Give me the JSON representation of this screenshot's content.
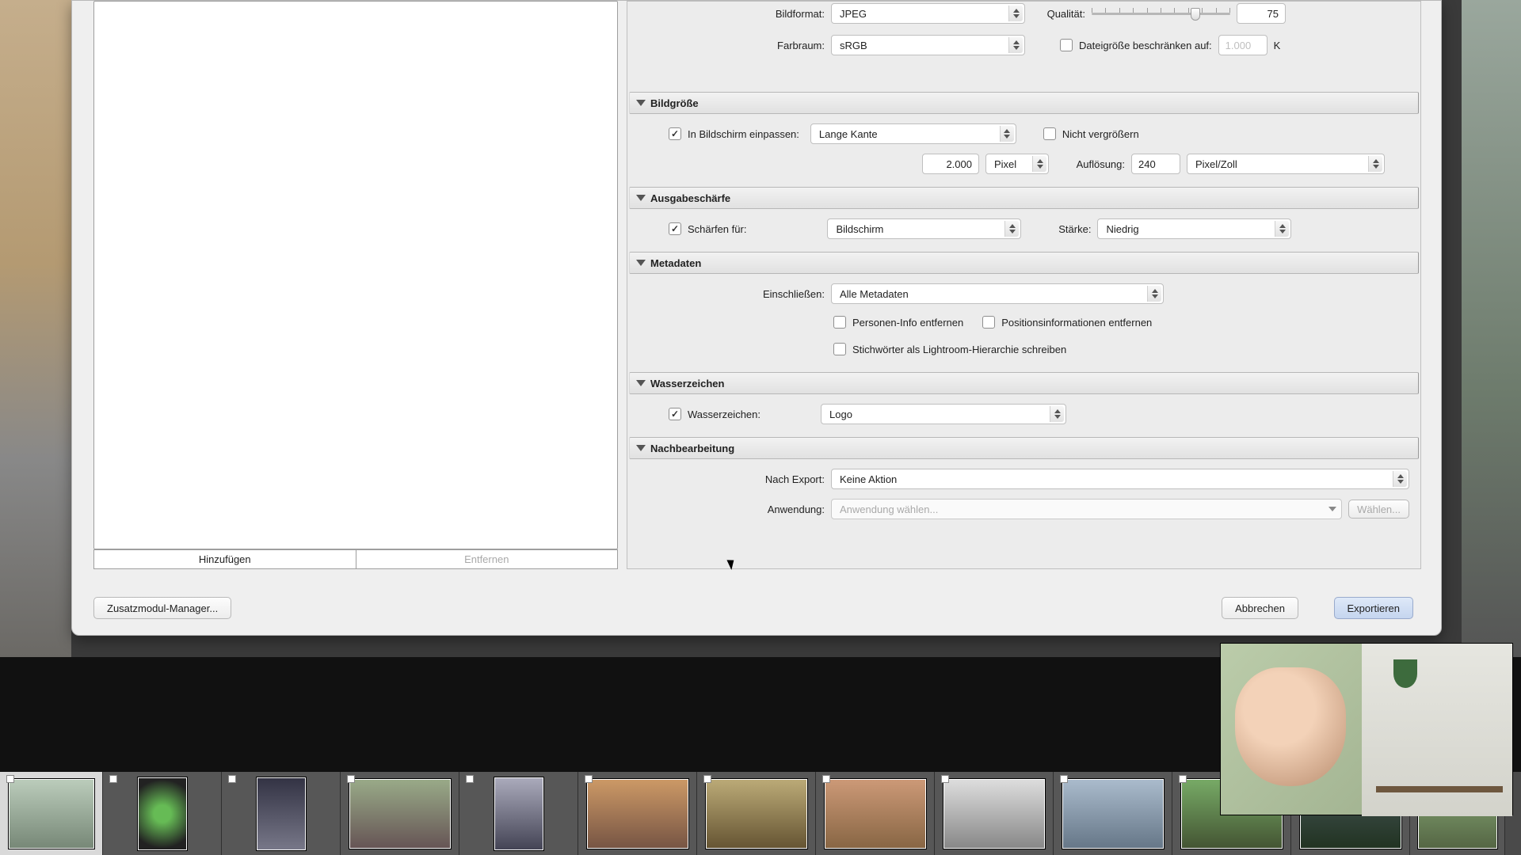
{
  "file_settings": {
    "format_label": "Bildformat:",
    "format_value": "JPEG",
    "quality_label": "Qualität:",
    "quality_value": "75",
    "quality_percent": 75,
    "colorspace_label": "Farbraum:",
    "colorspace_value": "sRGB",
    "limit_label": "Dateigröße beschränken auf:",
    "limit_value": "1.000",
    "limit_unit": "K"
  },
  "sections": {
    "size": {
      "title": "Bildgröße",
      "fit_label": "In Bildschirm einpassen:",
      "fit_value": "Lange Kante",
      "noenlarge": "Nicht vergrößern",
      "dim_value": "2.000",
      "dim_unit": "Pixel",
      "res_label": "Auflösung:",
      "res_value": "240",
      "res_unit": "Pixel/Zoll"
    },
    "sharpen": {
      "title": "Ausgabeschärfe",
      "for_label": "Schärfen für:",
      "for_value": "Bildschirm",
      "amount_label": "Stärke:",
      "amount_value": "Niedrig"
    },
    "meta": {
      "title": "Metadaten",
      "include_label": "Einschließen:",
      "include_value": "Alle Metadaten",
      "remove_person": "Personen-Info entfernen",
      "remove_location": "Positionsinformationen entfernen",
      "keyword_hier": "Stichwörter als Lightroom-Hierarchie schreiben"
    },
    "watermark": {
      "title": "Wasserzeichen",
      "label": "Wasserzeichen:",
      "value": "Logo"
    },
    "post": {
      "title": "Nachbearbeitung",
      "after_label": "Nach Export:",
      "after_value": "Keine Aktion",
      "app_label": "Anwendung:",
      "app_placeholder": "Anwendung wählen...",
      "choose": "Wählen..."
    }
  },
  "left_buttons": {
    "add": "Hinzufügen",
    "remove": "Entfernen"
  },
  "footer": {
    "plugin": "Zusatzmodul-Manager...",
    "cancel": "Abbrechen",
    "export": "Exportieren"
  }
}
